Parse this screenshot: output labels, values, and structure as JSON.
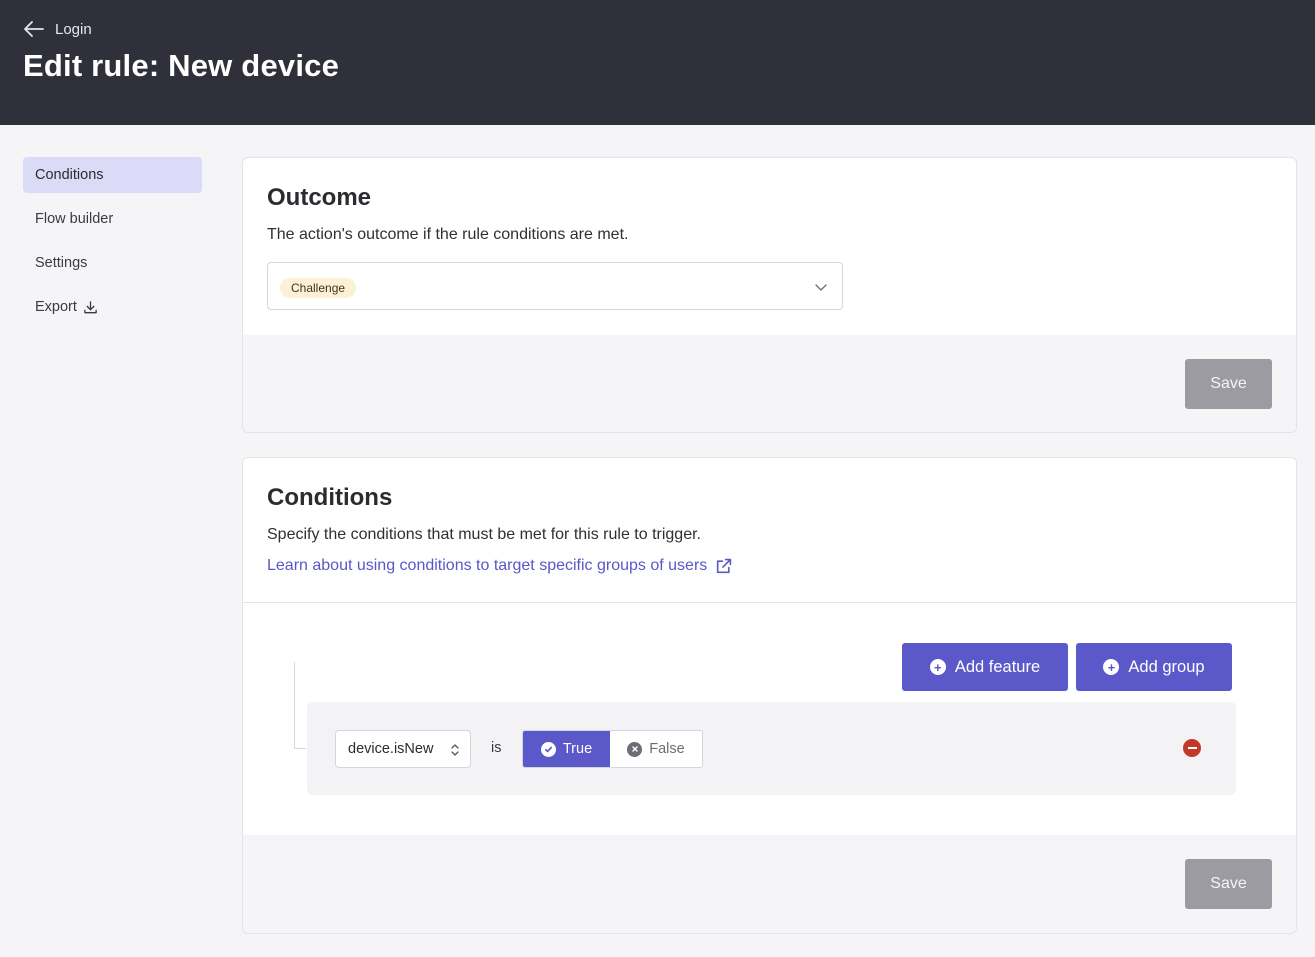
{
  "header": {
    "back_label": "Login",
    "title": "Edit rule: New device"
  },
  "sidebar": {
    "items": [
      {
        "label": "Conditions",
        "active": true
      },
      {
        "label": "Flow builder",
        "active": false
      },
      {
        "label": "Settings",
        "active": false
      },
      {
        "label": "Export",
        "active": false,
        "icon": "download-icon"
      }
    ]
  },
  "outcome": {
    "title": "Outcome",
    "description": "The action's outcome if the rule conditions are met.",
    "selected_value": "Challenge",
    "save_label": "Save"
  },
  "conditions": {
    "title": "Conditions",
    "description": "Specify the conditions that must be met for this rule to trigger.",
    "learn_link": "Learn about using conditions to target specific groups of users",
    "add_feature_label": "Add feature",
    "add_group_label": "Add group",
    "rows": [
      {
        "feature": "device.isNew",
        "operator": "is",
        "true_label": "True",
        "false_label": "False",
        "selected": "True"
      }
    ],
    "save_label": "Save"
  },
  "colors": {
    "header_bg": "#30303a",
    "accent": "#5b59c9",
    "sidebar_active": "#dcdbf7",
    "badge_bg": "#fbf1d6",
    "remove": "#c0392b",
    "save_disabled": "#9b9ba1"
  }
}
